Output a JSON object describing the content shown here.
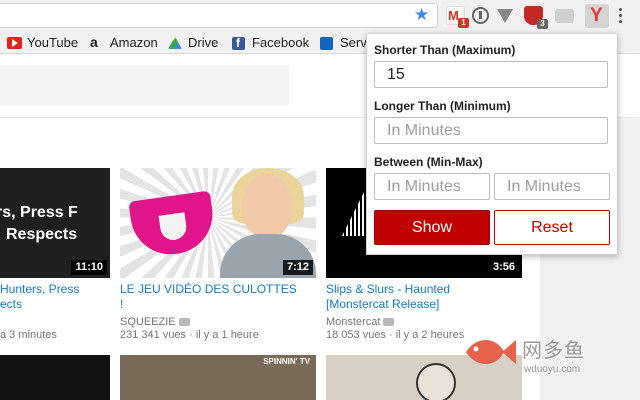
{
  "toolbar": {
    "badges": {
      "gmail": "1",
      "shield": "3"
    },
    "extension_letter": "Y"
  },
  "bookmarks": [
    {
      "label": "YouTube"
    },
    {
      "label": "Amazon"
    },
    {
      "label": "Drive"
    },
    {
      "label": "Facebook"
    },
    {
      "label": "Serv"
    }
  ],
  "videos": [
    {
      "overlay_line1": "rs, Press F",
      "overlay_line2": "Respects",
      "duration": "11:10",
      "title": "Hunters, Press\nects",
      "channel": "",
      "views": "a 3 minutes",
      "age": ""
    },
    {
      "duration": "7:12",
      "title": "LE JEU VIDÉO DES CULOTTES\n!",
      "channel": "SQUEEZIE",
      "views": "231 341 vues",
      "age": "il y a 1 heure"
    },
    {
      "duration": "3:56",
      "title": "Slips & Slurs - Haunted\n[Monstercat Release]",
      "channel": "Monstercat",
      "views": "18 053 vues",
      "age": "il y a 2 heures"
    }
  ],
  "row2": {
    "spinnin_label": "SPINNIN' TV"
  },
  "popup": {
    "shorter_label": "Shorter Than (Maximum)",
    "shorter_value": "15",
    "longer_label": "Longer Than (Minimum)",
    "longer_placeholder": "In Minutes",
    "between_label": "Between (Min-Max)",
    "between_min_placeholder": "In Minutes",
    "between_max_placeholder": "In Minutes",
    "show_label": "Show",
    "reset_label": "Reset"
  },
  "watermark": {
    "text": "网多鱼",
    "url": "wduoyu.com"
  },
  "colors": {
    "accent_red": "#c00000",
    "link_blue": "#167ac6"
  }
}
